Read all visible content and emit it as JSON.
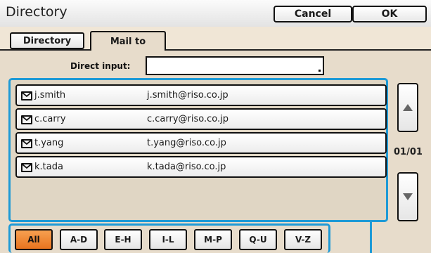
{
  "window": {
    "title": "Directory",
    "cancel_label": "Cancel",
    "ok_label": "OK"
  },
  "tabs": [
    {
      "label": "Directory",
      "active": false
    },
    {
      "label": "Mail to",
      "active": true
    }
  ],
  "direct_input": {
    "label": "Direct input:",
    "value": ""
  },
  "contacts": [
    {
      "name": "j.smith",
      "email": "j.smith@riso.co.jp",
      "icon": "mail-icon"
    },
    {
      "name": "c.carry",
      "email": "c.carry@riso.co.jp",
      "icon": "mail-icon"
    },
    {
      "name": "t.yang",
      "email": "t.yang@riso.co.jp",
      "icon": "mail-icon"
    },
    {
      "name": "k.tada",
      "email": "k.tada@riso.co.jp",
      "icon": "mail-icon"
    }
  ],
  "pagination": {
    "page_label": "01/01"
  },
  "filters": [
    {
      "label": "All",
      "selected": true
    },
    {
      "label": "A-D",
      "selected": false
    },
    {
      "label": "E-H",
      "selected": false
    },
    {
      "label": "I-L",
      "selected": false
    },
    {
      "label": "M-P",
      "selected": false
    },
    {
      "label": "Q-U",
      "selected": false
    },
    {
      "label": "V-Z",
      "selected": false
    }
  ],
  "colors": {
    "highlight": "#1e9ad6",
    "selected_filter": "#e8741f",
    "panel_bg": "#e7dccb"
  }
}
